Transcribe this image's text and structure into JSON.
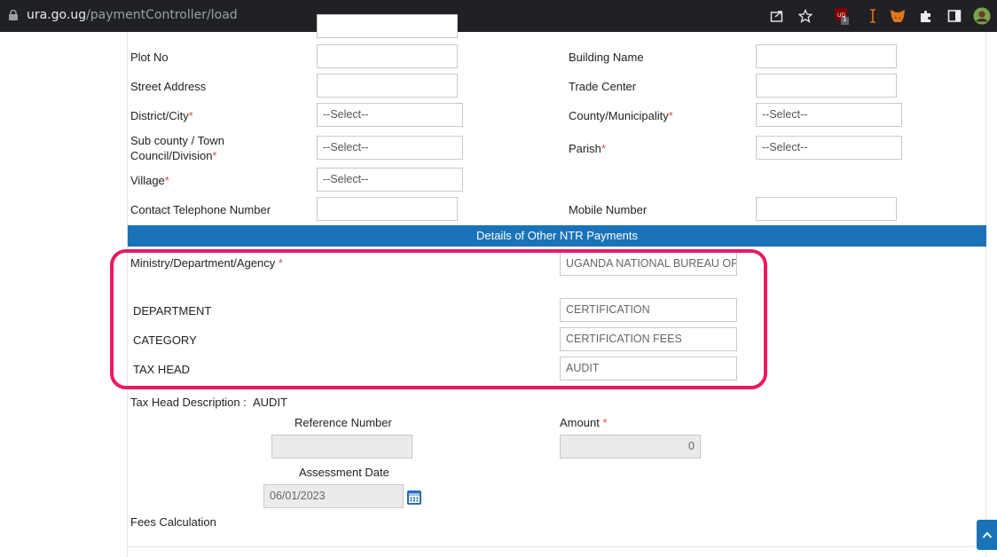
{
  "browser": {
    "domain": "ura.go.ug",
    "path": "/paymentController/load",
    "extension_badge": "1"
  },
  "form": {
    "plot_no_label": "Plot No",
    "building_name_label": "Building Name",
    "street_address_label": "Street Address",
    "trade_center_label": "Trade Center",
    "district_label": "District/City",
    "district_value": "--Select--",
    "county_label": "County/Municipality",
    "county_value": "--Select--",
    "subcounty_label_1": "Sub county / Town",
    "subcounty_label_2": "Council/Division",
    "subcounty_value": "--Select--",
    "parish_label": "Parish",
    "parish_value": "--Select--",
    "village_label": "Village",
    "village_value": "--Select--",
    "contact_tel_label": "Contact Telephone Number",
    "mobile_label": "Mobile Number",
    "required_mark": "*"
  },
  "ntr": {
    "section_title": "Details of Other NTR Payments",
    "mda_label": "Ministry/Department/Agency",
    "mda_value": "UGANDA NATIONAL BUREAU OF STANDARDS",
    "department_label": "DEPARTMENT",
    "department_value": "CERTIFICATION",
    "category_label": "CATEGORY",
    "category_value": "CERTIFICATION FEES",
    "tax_head_label": "TAX HEAD",
    "tax_head_value": "AUDIT",
    "tax_head_desc_label": "Tax Head Description :",
    "tax_head_desc_value": "AUDIT",
    "reference_label": "Reference Number",
    "reference_value": "",
    "amount_label": "Amount",
    "amount_value": "0",
    "assessment_label": "Assessment Date",
    "assessment_value": "06/01/2023",
    "fees_calc_label": "Fees Calculation"
  }
}
